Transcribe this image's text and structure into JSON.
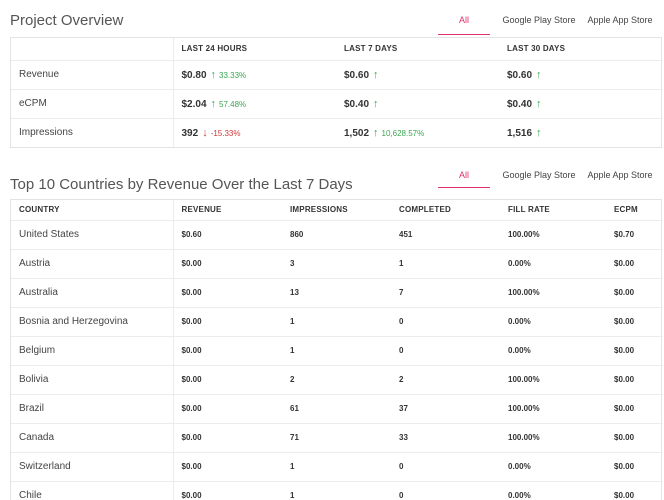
{
  "overview": {
    "title": "Project Overview",
    "tabs": [
      "All",
      "Google Play Store",
      "Apple App Store"
    ],
    "columns": [
      "LAST 24 HOURS",
      "LAST 7 DAYS",
      "LAST 30 DAYS"
    ],
    "rows": [
      {
        "label": "Revenue",
        "cells": [
          {
            "value": "$0.80",
            "trend": "up",
            "pct": "33.33%"
          },
          {
            "value": "$0.60",
            "trend": "up",
            "pct": ""
          },
          {
            "value": "$0.60",
            "trend": "up",
            "pct": ""
          }
        ]
      },
      {
        "label": "eCPM",
        "cells": [
          {
            "value": "$2.04",
            "trend": "up",
            "pct": "57.48%"
          },
          {
            "value": "$0.40",
            "trend": "up",
            "pct": ""
          },
          {
            "value": "$0.40",
            "trend": "up",
            "pct": ""
          }
        ]
      },
      {
        "label": "Impressions",
        "cells": [
          {
            "value": "392",
            "trend": "down",
            "pct": "-15.33%"
          },
          {
            "value": "1,502",
            "trend": "up",
            "pct": "10,628.57%"
          },
          {
            "value": "1,516",
            "trend": "up",
            "pct": ""
          }
        ]
      }
    ]
  },
  "countries": {
    "title": "Top 10 Countries by Revenue Over the Last 7 Days",
    "tabs": [
      "All",
      "Google Play Store",
      "Apple App Store"
    ],
    "columns": [
      "COUNTRY",
      "REVENUE",
      "IMPRESSIONS",
      "COMPLETED",
      "FILL RATE",
      "ECPM"
    ],
    "rows": [
      [
        "United States",
        "$0.60",
        "860",
        "451",
        "100.00%",
        "$0.70"
      ],
      [
        "Austria",
        "$0.00",
        "3",
        "1",
        "0.00%",
        "$0.00"
      ],
      [
        "Australia",
        "$0.00",
        "13",
        "7",
        "100.00%",
        "$0.00"
      ],
      [
        "Bosnia and Herzegovina",
        "$0.00",
        "1",
        "0",
        "0.00%",
        "$0.00"
      ],
      [
        "Belgium",
        "$0.00",
        "1",
        "0",
        "0.00%",
        "$0.00"
      ],
      [
        "Bolivia",
        "$0.00",
        "2",
        "2",
        "100.00%",
        "$0.00"
      ],
      [
        "Brazil",
        "$0.00",
        "61",
        "37",
        "100.00%",
        "$0.00"
      ],
      [
        "Canada",
        "$0.00",
        "71",
        "33",
        "100.00%",
        "$0.00"
      ],
      [
        "Switzerland",
        "$0.00",
        "1",
        "0",
        "0.00%",
        "$0.00"
      ],
      [
        "Chile",
        "$0.00",
        "1",
        "0",
        "0.00%",
        "$0.00"
      ]
    ]
  },
  "colors": {
    "accent": "#e0306a",
    "up": "#3aa652",
    "down": "#d13838"
  },
  "icons": {
    "up": "arrow-up-icon",
    "down": "arrow-down-icon"
  }
}
